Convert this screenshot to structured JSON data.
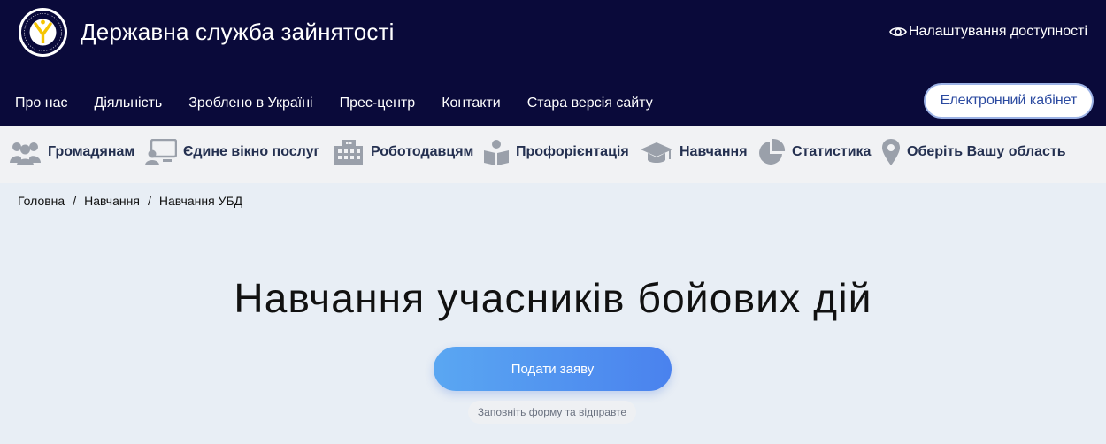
{
  "header": {
    "logo_text": "ДЕРЖАВНА СЛУЖБА ЗАЙНЯТОСТІ",
    "title": "Державна служба зайнятості",
    "accessibility_label": "Налаштування доступності",
    "cabinet_label": "Електронний кабінет",
    "nav": [
      "Про нас",
      "Діяльність",
      "Зроблено в Україні",
      "Прес-центр",
      "Контакти",
      "Стара версія сайту"
    ]
  },
  "categories": [
    {
      "label": "Громадянам",
      "icon": "people-icon"
    },
    {
      "label": "Єдине вікно послуг",
      "icon": "monitor-user-icon"
    },
    {
      "label": "Роботодавцям",
      "icon": "building-icon"
    },
    {
      "label": "Профорієнтація",
      "icon": "reader-icon"
    },
    {
      "label": "Навчання",
      "icon": "graduation-cap-icon"
    },
    {
      "label": "Статистика",
      "icon": "pie-chart-icon"
    },
    {
      "label": "Оберіть Вашу область",
      "icon": "map-pin-icon"
    }
  ],
  "breadcrumb": [
    "Головна",
    "Навчання",
    "Навчання УБД"
  ],
  "hero": {
    "title": "Навчання учасників бойових дій",
    "apply_label": "Подати заяву",
    "hint": "Заповніть форму та відправте"
  },
  "colors": {
    "header_bg": "#0a0a3a",
    "category_bg": "#f1f2f4",
    "page_bg": "#e8eef5",
    "accent": "#4a82ee",
    "logo_yellow": "#f5c400"
  }
}
